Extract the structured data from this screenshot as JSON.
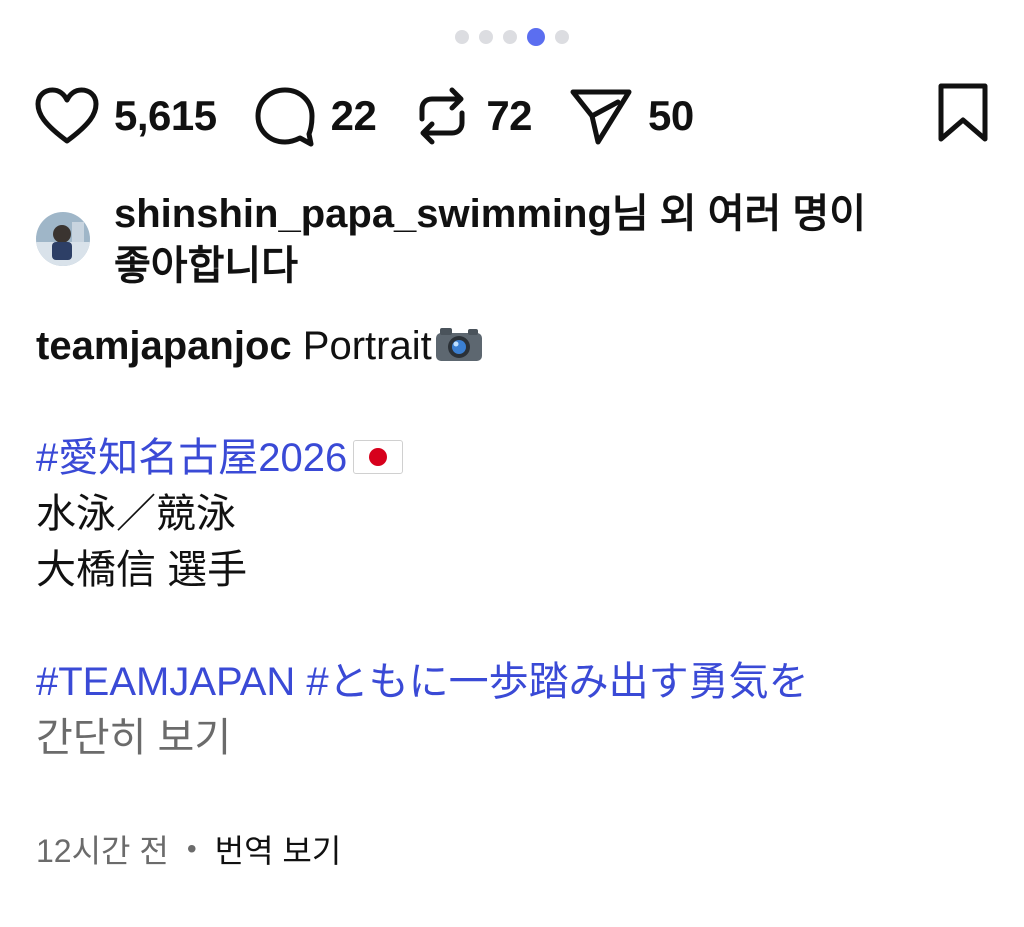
{
  "carousel": {
    "total": 5,
    "active_index": 3
  },
  "actions": {
    "likes": "5,615",
    "comments": "22",
    "reposts": "72",
    "shares": "50"
  },
  "liked_by": {
    "username": "shinshin_papa_swimming",
    "suffix": "님 외 여러 명이",
    "line2": "좋아합니다"
  },
  "caption": {
    "username": "teamjapanjoc",
    "text": " Portrait",
    "hashtag1": "#愛知名古屋2026",
    "line_sport": "水泳／競泳",
    "line_athlete": "大橋信 選手",
    "hashtags2": "#TEAMJAPAN #ともに一歩踏み出す勇気を",
    "collapse_label": "간단히 보기"
  },
  "meta": {
    "time": "12시간 전",
    "separator": "•",
    "translate_label": "번역 보기"
  },
  "colors": {
    "hashtag": "#3a4ad6",
    "dot_active": "#5b6ef0",
    "dot_inactive": "#dcdde1",
    "muted": "#6b6b6b"
  },
  "icons": [
    "heart-icon",
    "comment-icon",
    "repost-icon",
    "send-icon",
    "bookmark-icon",
    "camera-emoji",
    "japan-flag-emoji"
  ]
}
